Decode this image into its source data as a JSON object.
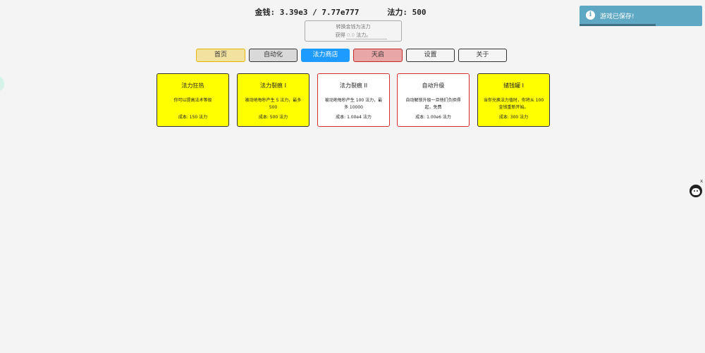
{
  "stats": {
    "money_label": "金钱:",
    "money_value": "3.39e3 / 7.77e777",
    "mana_label": "法力:",
    "mana_value": "500"
  },
  "convert": {
    "title": "转换金钱为法力",
    "gain_prefix": "获得",
    "gain_value": "0.0",
    "gain_suffix": "法力。"
  },
  "tabs": [
    {
      "label": "首页",
      "bg": "#f2e2a0",
      "border": "#e6b400"
    },
    {
      "label": "自动化",
      "bg": "#d9d9d9",
      "border": "#333333"
    },
    {
      "label": "法力商店",
      "bg": "#1e9bff",
      "border": "#1e9bff",
      "color": "#ffffff"
    },
    {
      "label": "天启",
      "bg": "#e8a6a6",
      "border": "#c62828"
    },
    {
      "label": "设置",
      "bg": "#f4f4f4",
      "border": "#333333"
    },
    {
      "label": "关于",
      "bg": "#f4f4f4",
      "border": "#333333"
    }
  ],
  "cards": [
    {
      "title": "法力狂热",
      "desc": "你可以提高法术等级",
      "cost": "成本: 150 法力",
      "bg": "#ffff00",
      "border": "#333333"
    },
    {
      "title": "法力裂痕 I",
      "desc": "被动地每秒产生 5 法力，最多 500",
      "cost": "成本: 500 法力",
      "bg": "#ffff00",
      "border": "#333333"
    },
    {
      "title": "法力裂痕 II",
      "desc": "被动地每秒产生 100 法力，最多 10000",
      "cost": "成本: 1.00e4 法力",
      "bg": "#ffffff",
      "border": "#d32f2f"
    },
    {
      "title": "自动升级",
      "desc": "自动解锁升级一旦他们负担得起，免费",
      "cost": "成本: 1.00e6 法力",
      "bg": "#ffffff",
      "border": "#d32f2f"
    },
    {
      "title": "储钱罐 I",
      "desc": "当你兑换法力值时，你将从 100 金钱重新开始。",
      "cost": "成本: 300 法力",
      "bg": "#ffff00",
      "border": "#333333"
    }
  ],
  "toast": {
    "message": "游戏已保存!",
    "icon": "info-icon",
    "progress": 0.62
  },
  "close_label": "x"
}
